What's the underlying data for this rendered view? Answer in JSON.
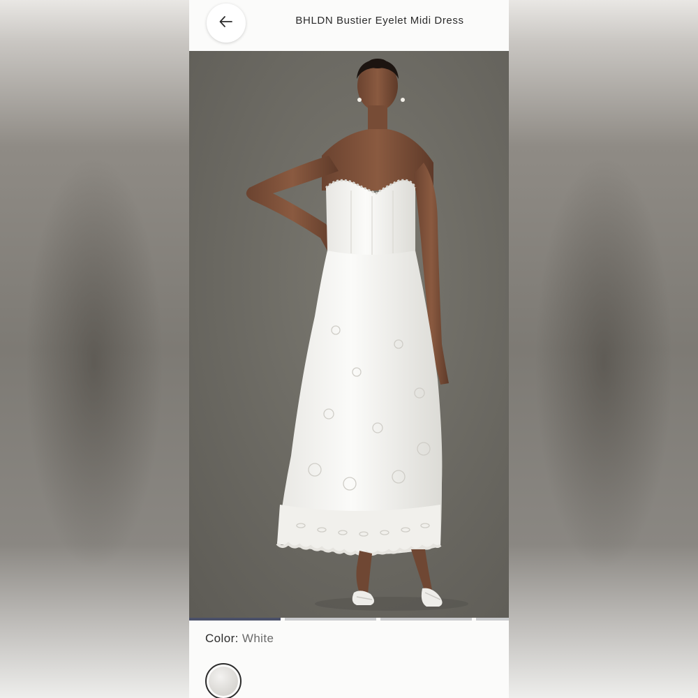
{
  "header": {
    "title": "BHLDN Bustier Eyelet Midi Dress",
    "back_icon": "arrow-left-icon"
  },
  "gallery": {
    "image_alt": "Model wearing a white strapless eyelet midi dress with white heeled sandals",
    "slide_count": 4,
    "active_slide": 1
  },
  "product": {
    "color_label": "Color:",
    "color_value": "White",
    "swatches": [
      {
        "name": "White",
        "selected": true
      }
    ]
  },
  "colors": {
    "active_indicator": "#4a5068",
    "inactive_indicator": "#c9cacd",
    "page_bg": "#fbfbfa",
    "text": "#2b2b2b"
  }
}
